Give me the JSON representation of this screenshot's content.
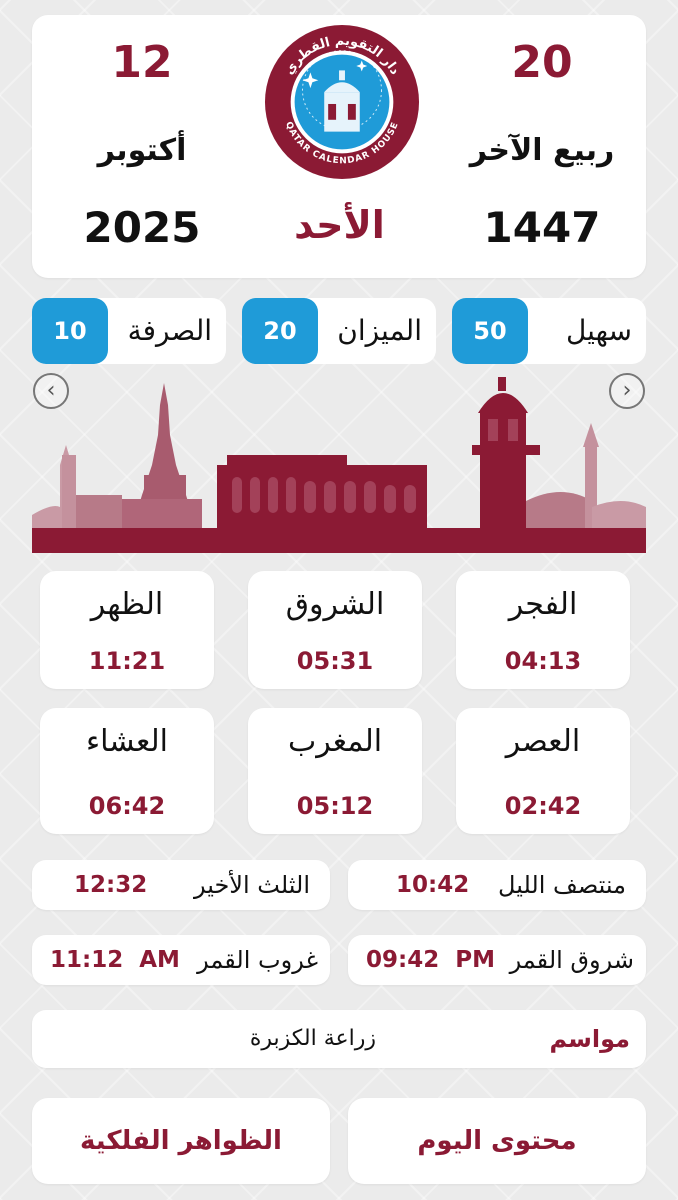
{
  "header": {
    "hijri_day": "20",
    "hijri_month": "ربيع الآخر",
    "hijri_year": "1447",
    "gregorian_day": "12",
    "gregorian_month": "أكتوبر",
    "gregorian_year": "2025",
    "weekday": "الأحد",
    "logo_text_arabic": "دار التقويم القطري",
    "logo_text_english": "QATAR CALENDAR HOUSE"
  },
  "seasons": [
    {
      "label": "سهيل",
      "value": "50"
    },
    {
      "label": "الميزان",
      "value": "20"
    },
    {
      "label": "الصرفة",
      "value": "10"
    }
  ],
  "prayers": [
    {
      "name": "الفجر",
      "time": "04:13"
    },
    {
      "name": "الشروق",
      "time": "05:31"
    },
    {
      "name": "الظهر",
      "time": "11:21"
    },
    {
      "name": "العصر",
      "time": "02:42"
    },
    {
      "name": "المغرب",
      "time": "05:12"
    },
    {
      "name": "العشاء",
      "time": "06:42"
    }
  ],
  "night": {
    "midnight_label": "منتصف الليل",
    "midnight_time": "10:42",
    "last_third_label": "الثلث الأخير",
    "last_third_time": "12:32"
  },
  "moon": {
    "rise_label": "شروق القمر",
    "rise_time": "09:42  PM",
    "set_label": "غروب القمر",
    "set_time": "11:12  AM"
  },
  "mawasim": {
    "label": "مواسم",
    "value": "زراعة الكزبرة"
  },
  "buttons": {
    "today_content": "محتوى اليوم",
    "astro_phenomena": "الظواهر الفلكية"
  },
  "colors": {
    "maroon": "#8b1a34",
    "blue_badge": "#1f9bd8",
    "background": "#ebebeb"
  },
  "icons": {
    "prev": "chevron-left-icon",
    "next": "chevron-right-icon"
  }
}
